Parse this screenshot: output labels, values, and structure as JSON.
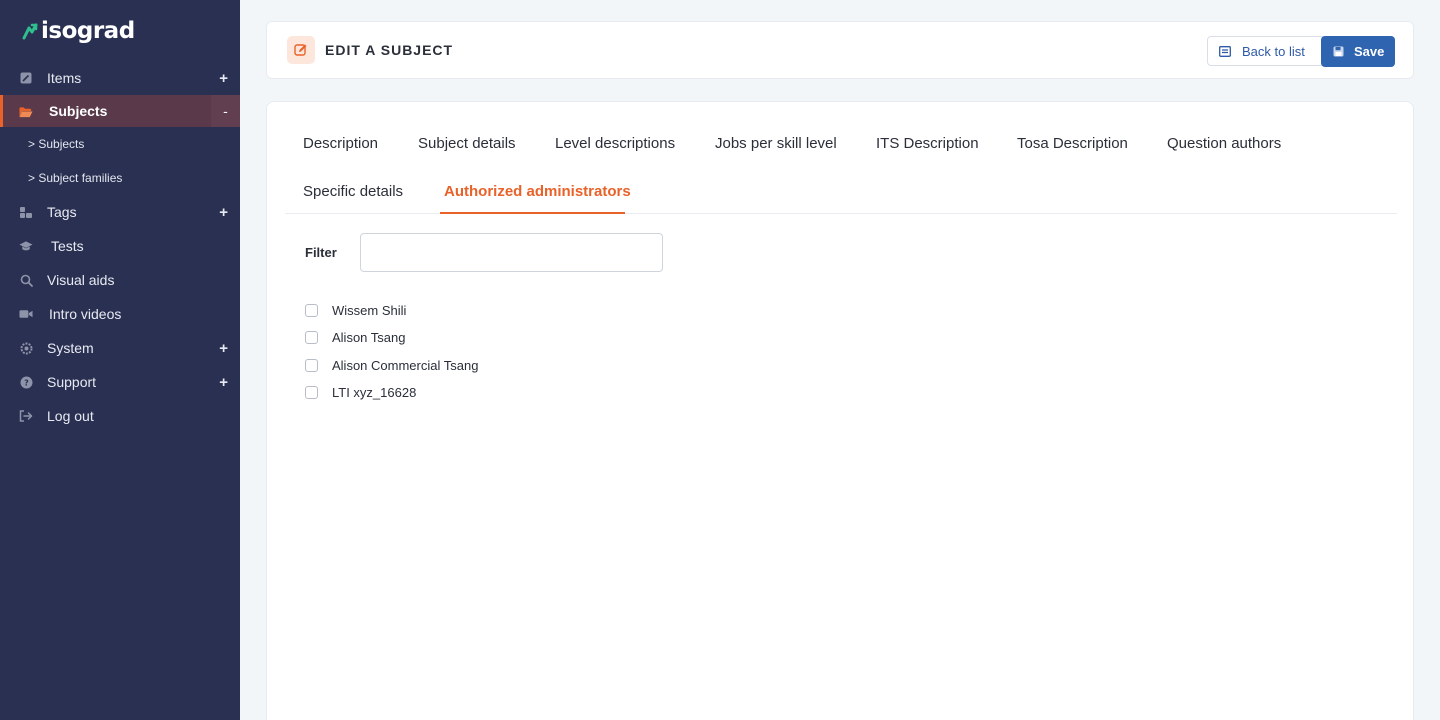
{
  "brand": {
    "name": "isograd",
    "accent": "#e8622a",
    "logo_mark_color": "#2fbf8f"
  },
  "sidebar": {
    "items": [
      {
        "label": "Items",
        "toggle": "+",
        "icon": "edit-icon"
      },
      {
        "label": "Subjects",
        "toggle": "-",
        "icon": "folder-open-icon",
        "active": true
      },
      {
        "label": "Tags",
        "toggle": "+",
        "icon": "tags-icon"
      },
      {
        "label": "Tests",
        "toggle": "",
        "icon": "graduation-cap-icon"
      },
      {
        "label": "Visual aids",
        "toggle": "",
        "icon": "search-icon"
      },
      {
        "label": "Intro videos",
        "toggle": "",
        "icon": "video-camera-icon"
      },
      {
        "label": "System",
        "toggle": "+",
        "icon": "gear-icon"
      },
      {
        "label": "Support",
        "toggle": "+",
        "icon": "question-circle-icon"
      },
      {
        "label": "Log out",
        "toggle": "",
        "icon": "logout-icon"
      }
    ],
    "subitems": [
      {
        "label": "> Subjects"
      },
      {
        "label": "> Subject families"
      }
    ]
  },
  "header": {
    "title": "EDIT A SUBJECT",
    "back_label": "Back to list",
    "save_label": "Save"
  },
  "tabs": [
    {
      "label": "Description"
    },
    {
      "label": "Subject details"
    },
    {
      "label": "Level descriptions"
    },
    {
      "label": "Jobs per skill level"
    },
    {
      "label": "ITS Description"
    },
    {
      "label": "Tosa Description"
    },
    {
      "label": "Question authors"
    },
    {
      "label": "Specific details"
    },
    {
      "label": "Authorized administrators",
      "active": true
    }
  ],
  "filter": {
    "label": "Filter",
    "value": "",
    "placeholder": ""
  },
  "administrators": [
    {
      "name": "Wissem Shili",
      "checked": false
    },
    {
      "name": "Alison Tsang",
      "checked": false
    },
    {
      "name": "Alison Commercial Tsang",
      "checked": false
    },
    {
      "name": "LTI xyz_16628",
      "checked": false
    }
  ]
}
